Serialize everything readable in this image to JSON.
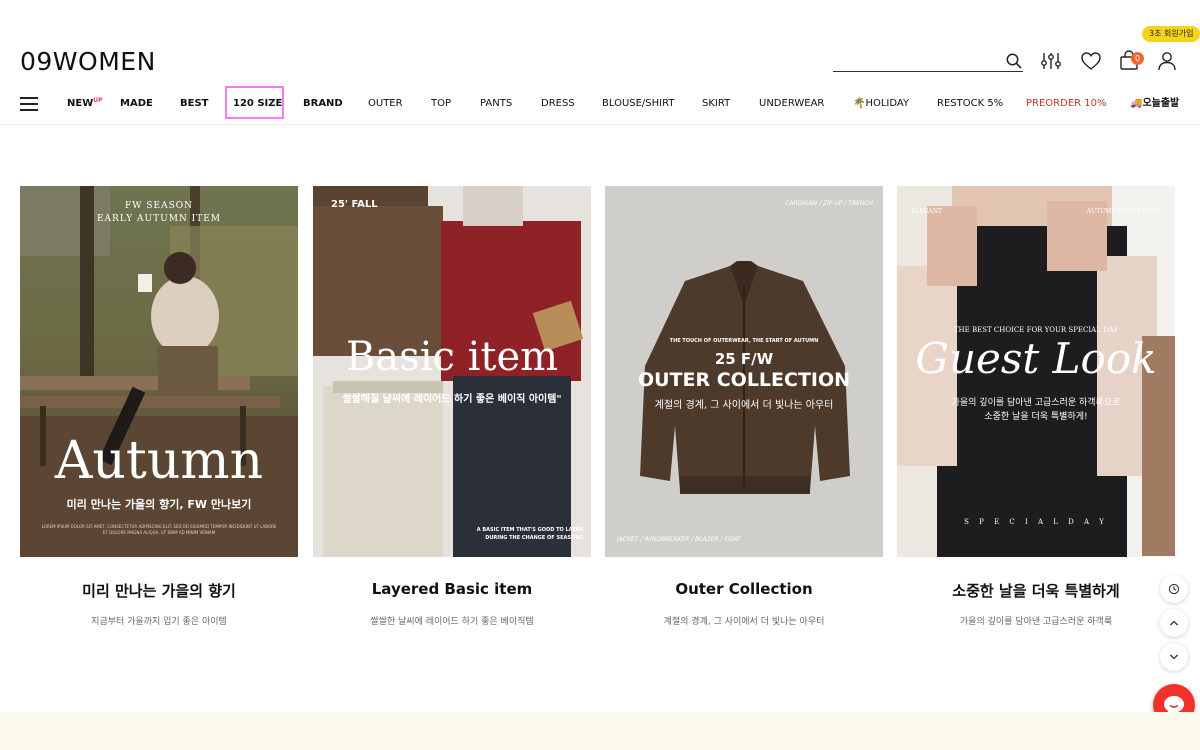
{
  "header": {
    "logo": "09WOMEN",
    "signup_badge": "3초 회원가입",
    "cart_count": "0",
    "search_placeholder": ""
  },
  "nav": {
    "items": [
      {
        "label": "NEW",
        "sup": "UP"
      },
      {
        "label": "MADE"
      },
      {
        "label": "BEST"
      },
      {
        "label": "120 SIZE"
      },
      {
        "label": "BRAND"
      },
      {
        "label": "OUTER"
      },
      {
        "label": "TOP"
      },
      {
        "label": "PANTS"
      },
      {
        "label": "DRESS"
      },
      {
        "label": "BLOUSE/SHIRT"
      },
      {
        "label": "SKIRT"
      },
      {
        "label": "UNDERWEAR"
      },
      {
        "label": "🌴HOLIDAY"
      },
      {
        "label": "RESTOCK 5%"
      },
      {
        "label": "PREORDER 10%"
      },
      {
        "label": "🚚오늘출발"
      }
    ],
    "highlight_color": "#f17df0",
    "preorder_color": "#c0392b"
  },
  "banners": [
    {
      "overlay_top": "FW SEASON",
      "overlay_top2": "EARLY AUTUMN ITEM",
      "overlay_big": "Autumn",
      "overlay_small": "미리 만나는 가을의 향기, FW 만나보기",
      "overlay_fine": "LOREM IPSUM DOLOR SIT AMET, CONSECTETUR ADIPISCING ELIT. SED DO EIUSMOD TEMPOR INCIDIDUNT UT LABORE ET DOLORE MAGNA ALIQUA. UT ENIM AD MINIM VENIAM",
      "title": "미리 만나는 가을의 향기",
      "subtitle": "지금부터 가을까지 입기 좋은 아이템"
    },
    {
      "overlay_top": "25' FALL",
      "overlay_big": "Basic item",
      "overlay_small": "쌀쌀해질 날씨에 레이어드 하기 좋은 베이직 아이템\"",
      "overlay_fine": "A BASIC ITEM THAT'S GOOD TO LAYER DURING THE CHANGE OF SEASONS",
      "title": "Layered Basic item",
      "subtitle": "쌀쌀한 날씨에 레이어드 하기 좋은 베이직템"
    },
    {
      "overlay_top": "CARDIGAN / ZIP-UP / TRENCH",
      "overlay_top2": "THE TOUCH OF OUTERWEAR, THE START OF AUTUMN",
      "overlay_mid": "25 F/W",
      "overlay_big": "OUTER COLLECTION",
      "overlay_small": "계절의 경계, 그 사이에서 더 빛나는 아우터",
      "overlay_fine": "JACKET / WINDBREAKER / BLAZER / COAT",
      "title": "Outer Collection",
      "subtitle": "계절의 경계, 그 사이에서 더 빛나는 아우터"
    },
    {
      "overlay_top": "ELEGANT",
      "overlay_top_right": "AUTUMN GUEST LOOK",
      "overlay_top2": "THE BEST CHOICE FOR YOUR SPECIAL DAY",
      "overlay_big": "Guest Look",
      "overlay_small": "가을의 깊이를 담아낸 고급스러운 하객룩으로",
      "overlay_small2": "소중한 날을 더욱 특별하게!",
      "overlay_fine": "S P E C I A L D A Y",
      "title": "소중한 날을 더욱 특별하게",
      "subtitle": "가을의 깊이를 담아낸 고급스러운 하객룩"
    }
  ],
  "colors": {
    "footer_band": "#fbf8ec",
    "chat": "#f2312b",
    "badge": "#f7d31a",
    "cart_count_bg": "#f2672e"
  }
}
